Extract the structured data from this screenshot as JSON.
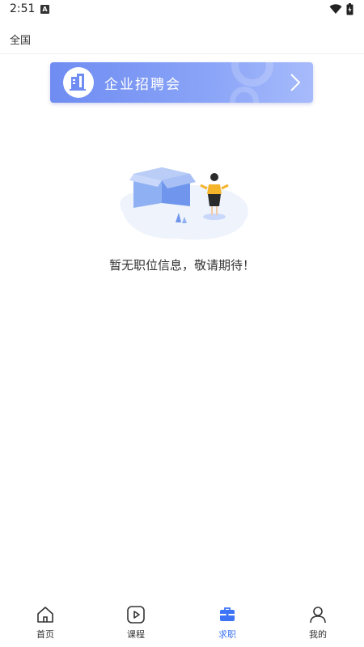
{
  "status_bar": {
    "time": "2:51",
    "notification_icon": "A"
  },
  "region": {
    "label": "全国"
  },
  "banner": {
    "title": "企业招聘会",
    "icon": "building-icon",
    "arrow_icon": "chevron-right-icon"
  },
  "empty_state": {
    "message": "暂无职位信息，敬请期待！",
    "illustration": "empty-box-illustration"
  },
  "bottom_nav": {
    "items": [
      {
        "label": "首页",
        "icon": "home-icon",
        "active": false
      },
      {
        "label": "课程",
        "icon": "play-icon",
        "active": false
      },
      {
        "label": "求职",
        "icon": "briefcase-icon",
        "active": true
      },
      {
        "label": "我的",
        "icon": "user-icon",
        "active": false
      }
    ]
  },
  "colors": {
    "accent": "#3d74f5",
    "banner_start": "#6f8cf2",
    "banner_end": "#a7bbfb"
  }
}
